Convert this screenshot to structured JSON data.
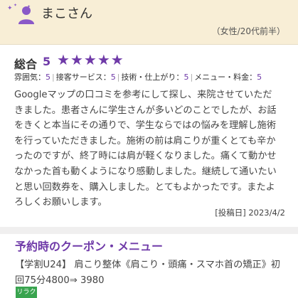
{
  "reviewer": {
    "name": "まこさん",
    "meta": "（女性/20代前半）",
    "avatar_icon": "person-icon",
    "sparkle_icon": "sparkle-icon",
    "accent_color": "#8a58c8"
  },
  "review": {
    "total_label": "総合",
    "total_score": "5",
    "stars": 5,
    "star_color": "#6f3aa8",
    "subscores": [
      {
        "label": "雰囲気",
        "value": "5"
      },
      {
        "label": "接客サービス",
        "value": "5"
      },
      {
        "label": "技術・仕上がり",
        "value": "5"
      },
      {
        "label": "メニュー・料金",
        "value": "5"
      }
    ],
    "text_lines": [
      "Googleマップの口コミを参考にして探し、来院させていただ",
      "きました。患者さんに学生さんが多いどのことでしたが、お話",
      "をきくと本当にその通りで、学生ならではの悩みを理解し施術",
      "を行っていただきました。施術の前は肩こりが重くとても辛か",
      "ったのですが、終了時には肩が軽くなりました。痛くて動かせ",
      "なかった首も動くようになり感動しました。継続して通いたい",
      "と思い回数券を、購入しました。とてもよかったです。またよ",
      "ろしくお願いします。"
    ],
    "posted_label": "[投稿日]",
    "posted_date": "2023/4/2"
  },
  "coupon": {
    "heading": "予約時のクーポン・メニュー",
    "lines": [
      "【学割U24】 肩こり整体《肩こり・頭痛・スマホ首の矯正》初",
      "回75分4800⇒ 3980"
    ],
    "badge": "リラク",
    "badge_color": "#39a44f"
  }
}
